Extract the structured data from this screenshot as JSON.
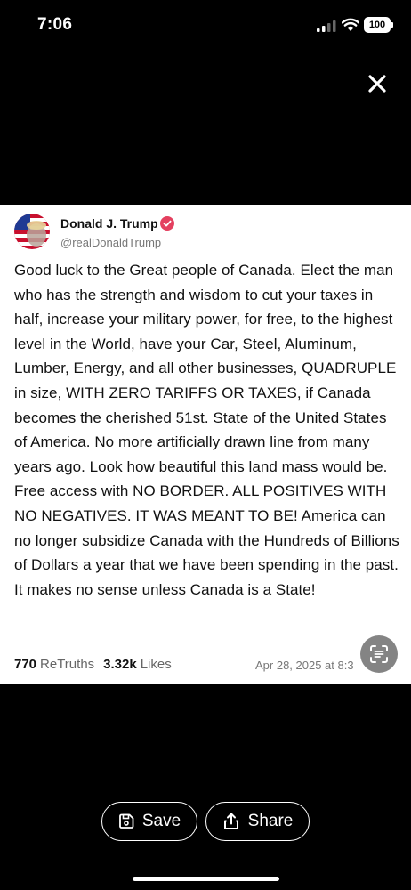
{
  "status_bar": {
    "time": "7:06",
    "battery": "100"
  },
  "post": {
    "author_name": "Donald J. Trump",
    "author_handle": "@realDonaldTrump",
    "text": "Good luck to the Great people of Canada. Elect the man who has the strength and wisdom to cut your taxes in half, increase your military power, for free, to the highest level in the World, have your Car, Steel, Aluminum, Lumber, Energy, and all other businesses, QUADRUPLE in size, WITH ZERO TARIFFS OR TAXES, if Canada becomes the cherished 51st. State of the United States of America. No more artificially drawn line from many years ago. Look how beautiful this land mass would be. Free access with NO BORDER. ALL POSITIVES WITH NO NEGATIVES. IT WAS MEANT TO BE! America can no longer subsidize Canada with the Hundreds of Billions of Dollars a year that we have been spending in the past. It makes no sense unless Canada is a State!",
    "retruths_count": "770",
    "retruths_label": "ReTruths",
    "likes_count": "3.32k",
    "likes_label": "Likes",
    "timestamp": "Apr 28, 2025 at 8:3"
  },
  "actions": {
    "save_label": "Save",
    "share_label": "Share"
  },
  "colors": {
    "verified_badge": "#e4405f",
    "background": "#000000",
    "card": "#ffffff"
  },
  "icons": [
    "signal-icon",
    "wifi-icon",
    "close-icon",
    "verified-icon",
    "scan-icon",
    "save-icon",
    "share-icon"
  ]
}
